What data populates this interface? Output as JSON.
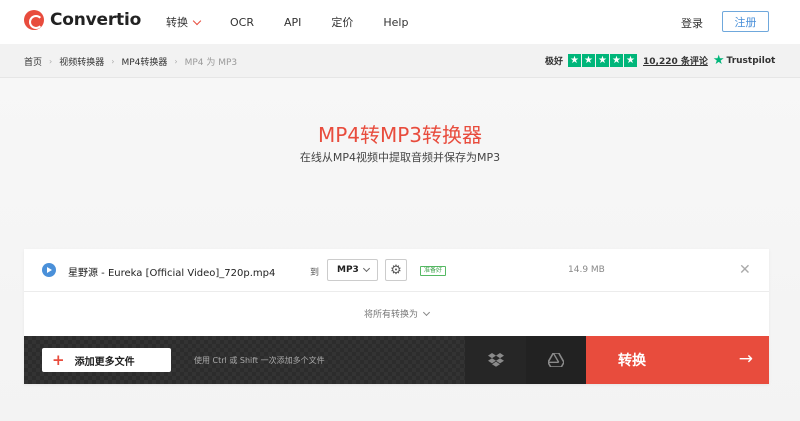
{
  "brand": {
    "name": "Convertio"
  },
  "nav": {
    "items": [
      "转换",
      "OCR",
      "API",
      "定价",
      "Help"
    ]
  },
  "auth": {
    "login": "登录",
    "register": "注册"
  },
  "breadcrumb": {
    "items": [
      "首页",
      "视频转换器",
      "MP4转换器"
    ],
    "current": "MP4 为 MP3"
  },
  "rating": {
    "label": "极好",
    "stars": 5,
    "reviews": "10,220 条评论",
    "provider": "Trustpilot"
  },
  "hero": {
    "title": "MP4转MP3转换器",
    "subtitle": "在线从MP4视频中提取音频并保存为MP3"
  },
  "file": {
    "name": "星野源 - Eureka [Official Video]_720p.mp4",
    "to_label": "到",
    "format": "MP3",
    "status": "准备好",
    "size": "14.9 MB"
  },
  "convert_all": {
    "label": "将所有转换为"
  },
  "actions": {
    "add_files": "添加更多文件",
    "hint": "使用 Ctrl 或 Shift 一次添加多个文件",
    "convert": "转换"
  },
  "colors": {
    "accent": "#e84c3d",
    "trustpilot": "#00b67a",
    "link_blue": "#4a90d9"
  }
}
